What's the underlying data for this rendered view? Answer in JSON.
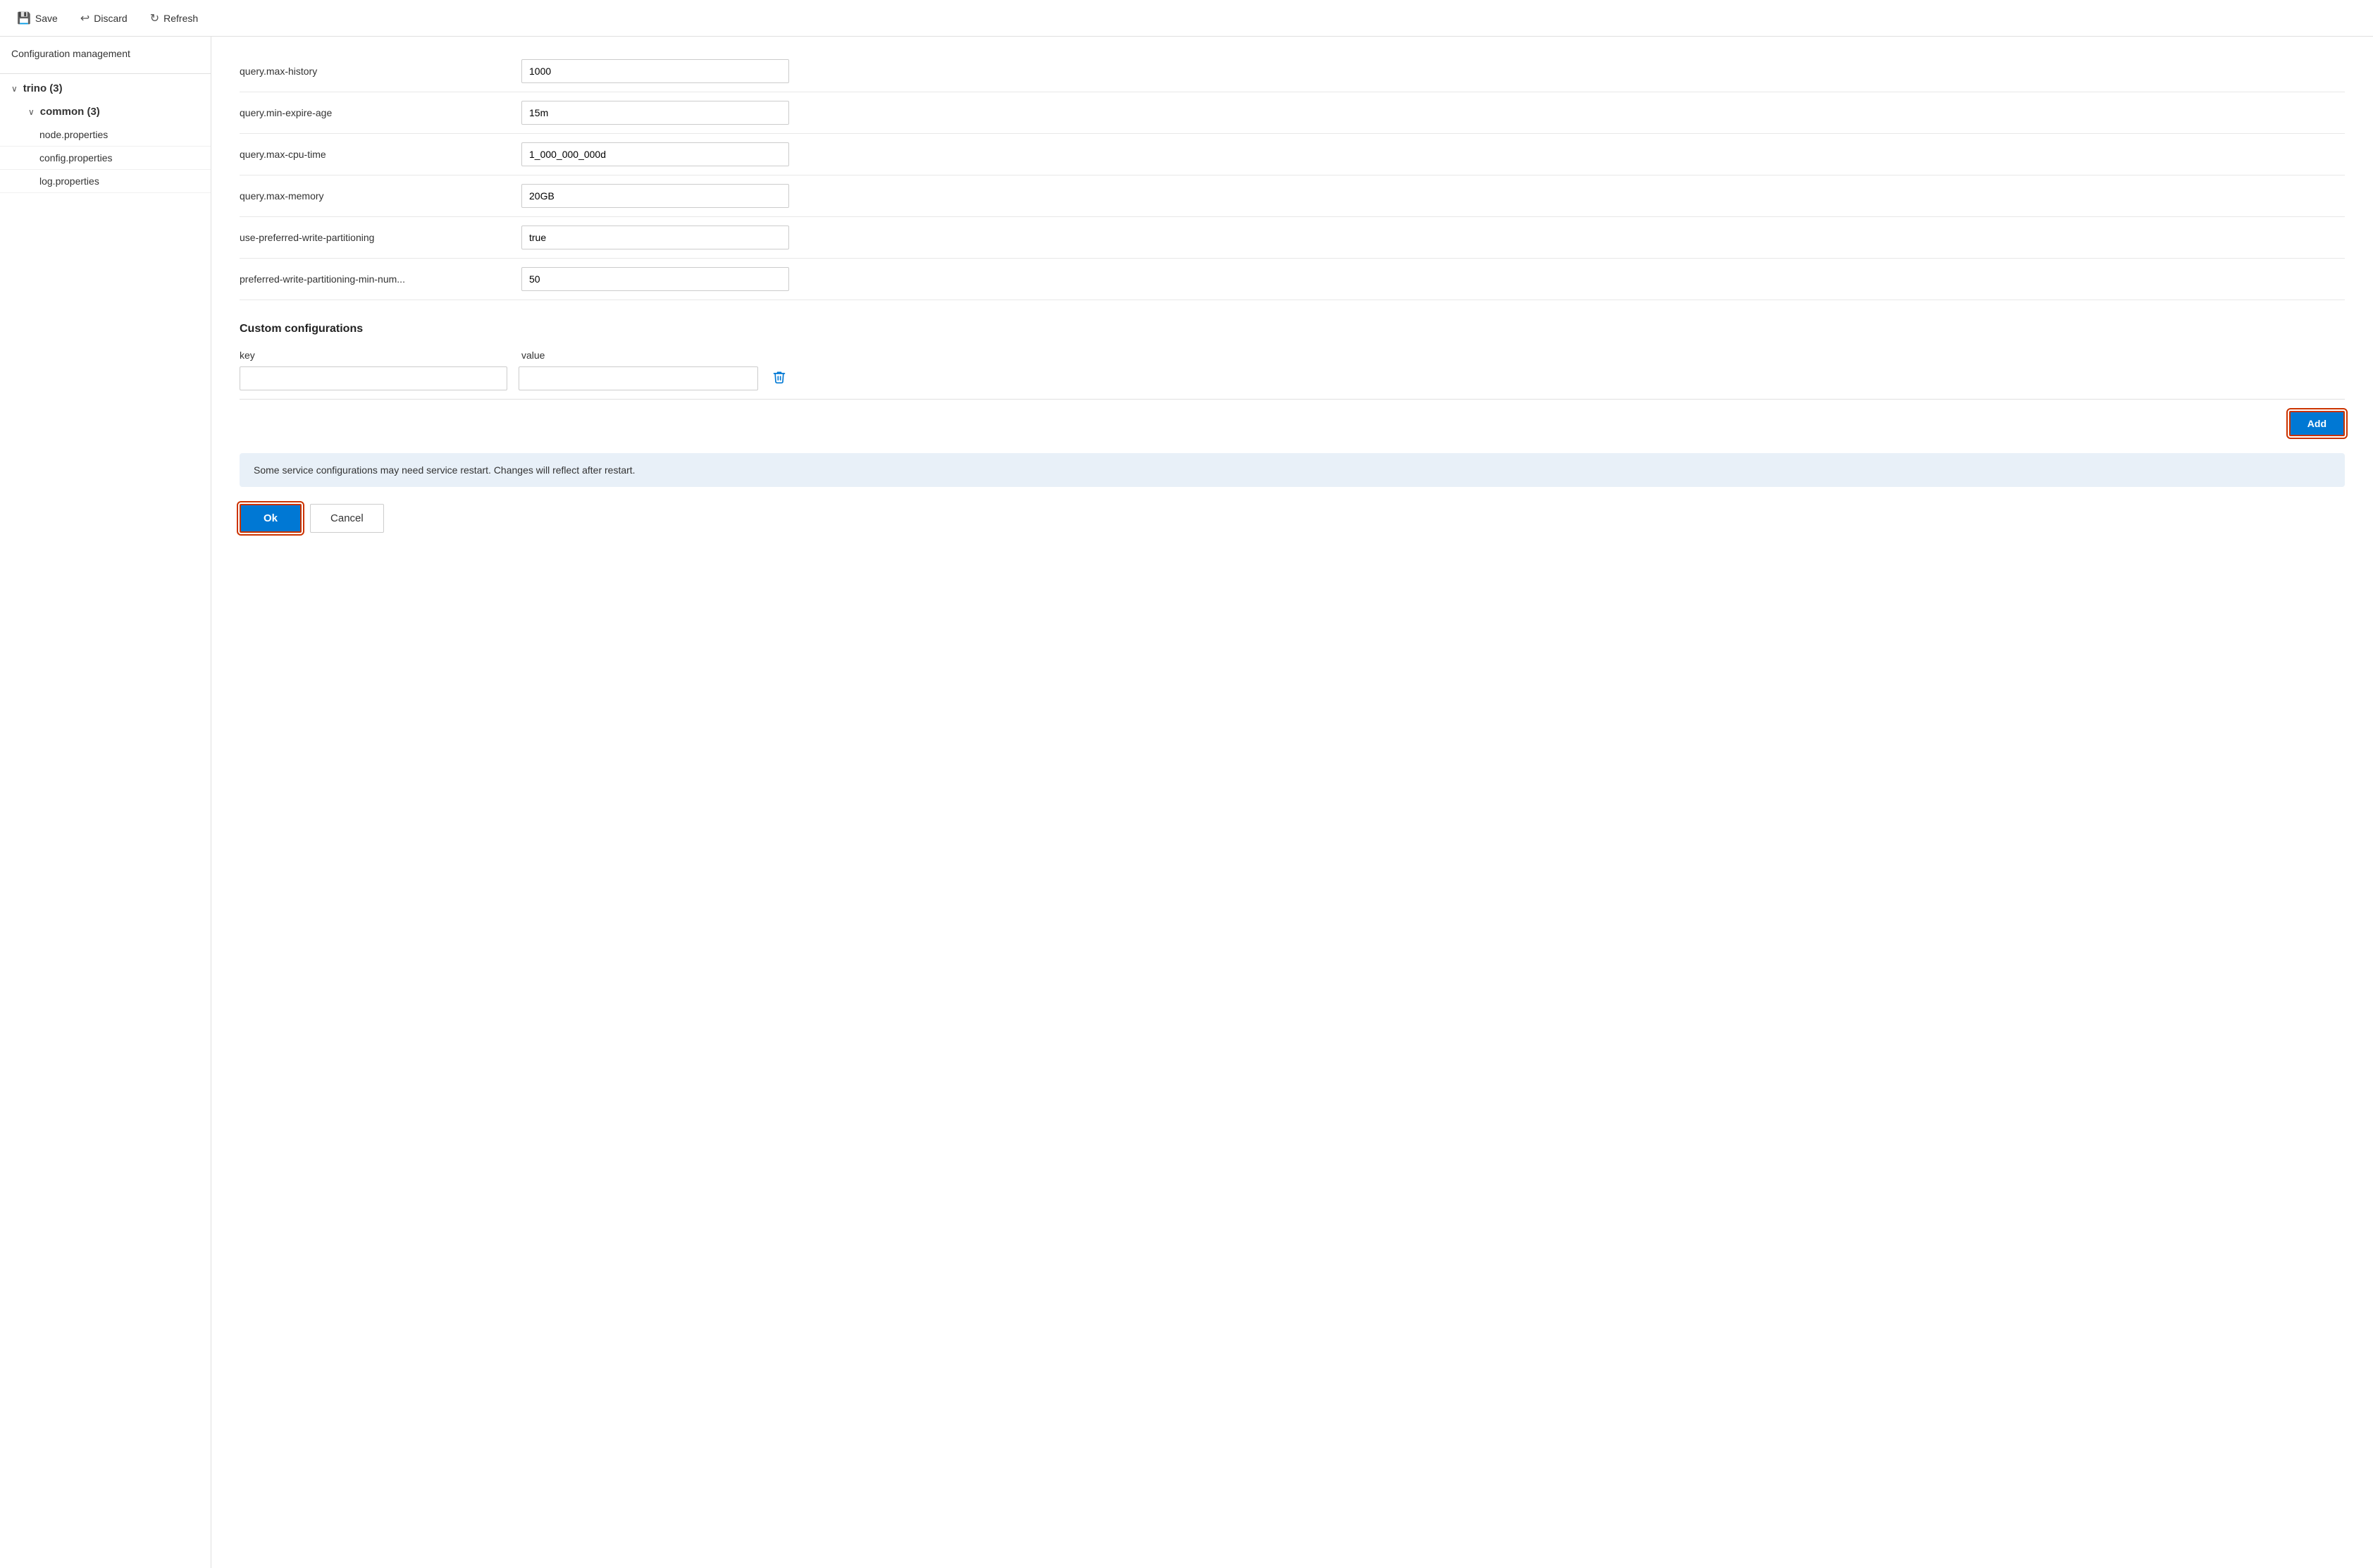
{
  "toolbar": {
    "save_label": "Save",
    "discard_label": "Discard",
    "refresh_label": "Refresh"
  },
  "sidebar": {
    "title": "Configuration management",
    "tree": {
      "root_label": "trino (3)",
      "child_label": "common (3)",
      "items": [
        {
          "label": "node.properties"
        },
        {
          "label": "config.properties"
        },
        {
          "label": "log.properties"
        }
      ]
    }
  },
  "config": {
    "rows": [
      {
        "key": "query.max-history",
        "value": "1000"
      },
      {
        "key": "query.min-expire-age",
        "value": "15m"
      },
      {
        "key": "query.max-cpu-time",
        "value": "1_000_000_000d"
      },
      {
        "key": "query.max-memory",
        "value": "20GB"
      },
      {
        "key": "use-preferred-write-partitioning",
        "value": "true"
      },
      {
        "key": "preferred-write-partitioning-min-num...",
        "value": "50"
      }
    ]
  },
  "custom_config": {
    "title": "Custom configurations",
    "key_header": "key",
    "value_header": "value",
    "key_placeholder": "",
    "value_placeholder": "",
    "add_label": "Add"
  },
  "info_banner": {
    "text": "Some service configurations may need service restart. Changes will reflect after restart."
  },
  "actions": {
    "ok_label": "Ok",
    "cancel_label": "Cancel"
  }
}
